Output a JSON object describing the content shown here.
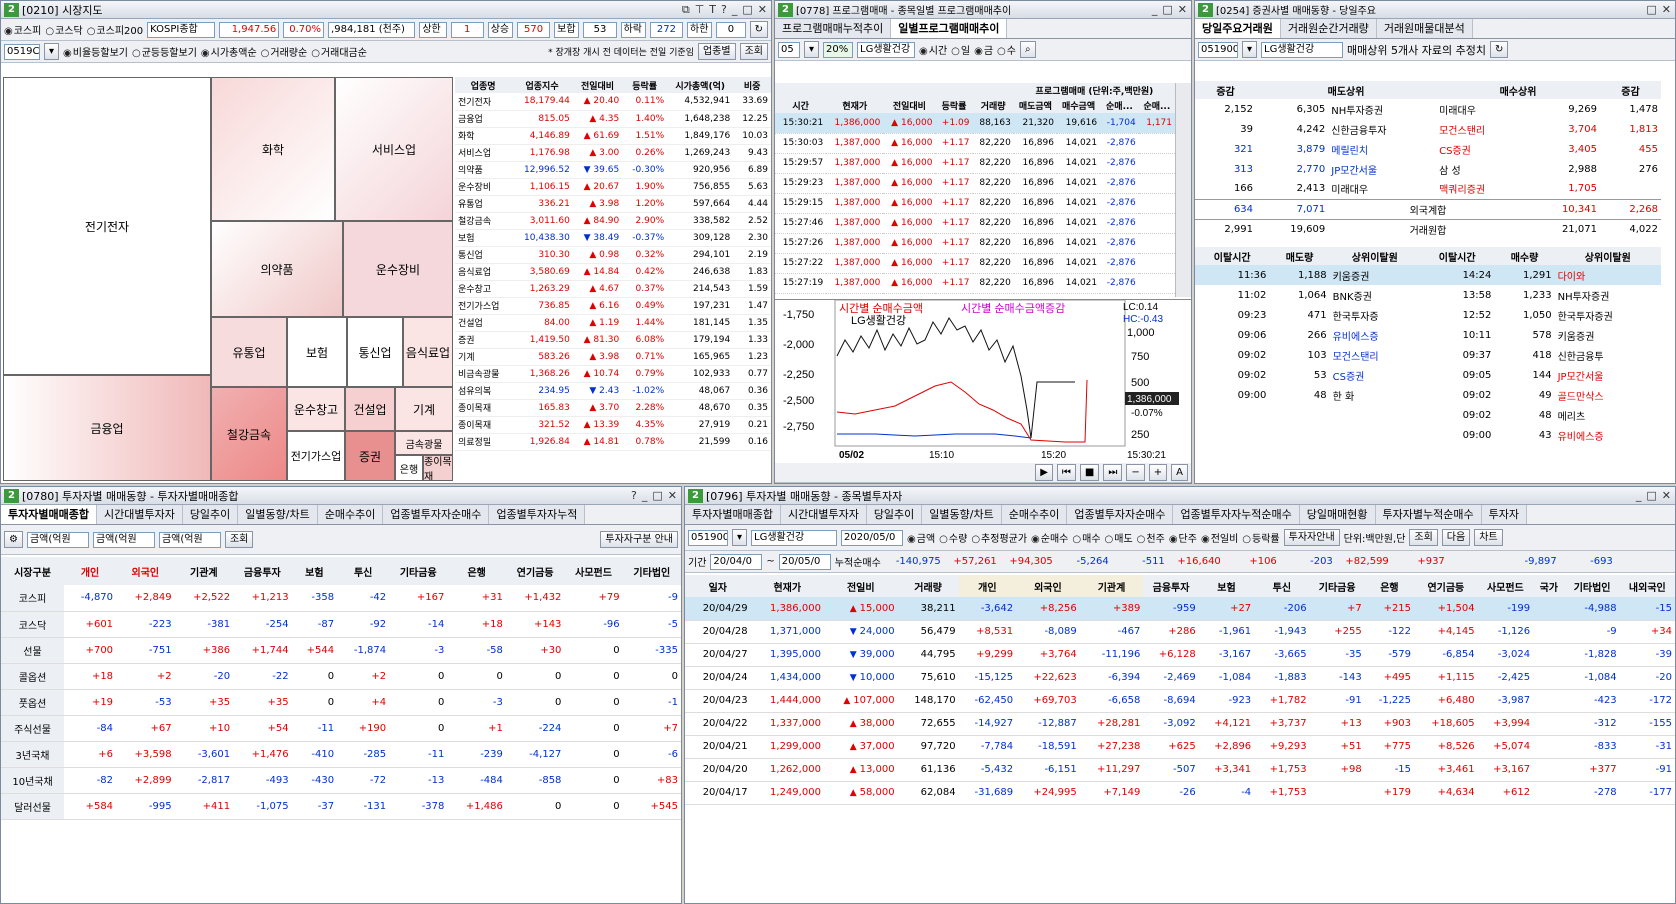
{
  "w1": {
    "num": "2",
    "title": "[0210] 시장지도",
    "markets": [
      "코스피",
      "코스닥",
      "코스피200"
    ],
    "index_name": "KOSPI종합",
    "index_val": "1,947.56",
    "index_pct": "0.70%",
    "index_amt": ",984,181 (천주)",
    "stats": [
      {
        "k": "상한",
        "v": "1"
      },
      {
        "k": "상승",
        "v": "570"
      },
      {
        "k": "보합",
        "v": "53"
      },
      {
        "k": "하락",
        "v": "272"
      },
      {
        "k": "하한",
        "v": "0"
      }
    ],
    "code": "0519C",
    "view_opts": [
      "비율등할보기",
      "균등등할보기"
    ],
    "size_opts": [
      "시가총액순",
      "거래량순",
      "거래대금순"
    ],
    "note": "* 장개장 개시 전 데이터는 전일 기준임",
    "btn_period": "업종별",
    "btn_search": "조회",
    "sectors": [
      "전기전자",
      "화학",
      "서비스업",
      "의약품",
      "운수장비",
      "유통업",
      "보험",
      "통신업",
      "음식료업",
      "금융업",
      "운수창고",
      "건설업",
      "기계",
      "철강금속",
      "전기가스업",
      "증권",
      "은행",
      "섬유의복",
      "종이목재",
      "금속광물"
    ],
    "table_head": [
      "업종명",
      "업종지수",
      "전일대비",
      "등락률",
      "시가총액(억)",
      "비중"
    ],
    "rows": [
      [
        "전기전자",
        "18,179.44",
        "up",
        "20.40",
        "0.11%",
        "4,532,941",
        "33.69"
      ],
      [
        "금융업",
        "815.05",
        "up",
        "4.35",
        "1.40%",
        "1,648,238",
        "12.25"
      ],
      [
        "화학",
        "4,146.89",
        "up",
        "61.69",
        "1.51%",
        "1,849,176",
        "10.03"
      ],
      [
        "서비스업",
        "1,176.98",
        "up",
        "3.00",
        "0.26%",
        "1,269,243",
        "9.43"
      ],
      [
        "의약품",
        "12,996.52",
        "dn",
        "39.65",
        "-0.30%",
        "920,956",
        "6.89"
      ],
      [
        "운수장비",
        "1,106.15",
        "up",
        "20.67",
        "1.90%",
        "756,855",
        "5.63"
      ],
      [
        "유통업",
        "336.21",
        "up",
        "3.98",
        "1.20%",
        "597,664",
        "4.44"
      ],
      [
        "철강금속",
        "3,011.60",
        "up",
        "84.90",
        "2.90%",
        "338,582",
        "2.52"
      ],
      [
        "보험",
        "10,438.30",
        "dn",
        "38.49",
        "-0.37%",
        "309,128",
        "2.30"
      ],
      [
        "통신업",
        "310.30",
        "up",
        "0.98",
        "0.32%",
        "294,101",
        "2.19"
      ],
      [
        "음식료업",
        "3,580.69",
        "up",
        "14.84",
        "0.42%",
        "246,638",
        "1.83"
      ],
      [
        "운수창고",
        "1,263.29",
        "up",
        "4.67",
        "0.37%",
        "214,543",
        "1.59"
      ],
      [
        "전기가스업",
        "736.85",
        "up",
        "6.16",
        "0.49%",
        "197,231",
        "1.47"
      ],
      [
        "건설업",
        "84.00",
        "up",
        "1.19",
        "1.44%",
        "181,145",
        "1.35"
      ],
      [
        "증권",
        "1,419.50",
        "up",
        "81.30",
        "6.08%",
        "179,194",
        "1.33"
      ],
      [
        "기계",
        "583.26",
        "up",
        "3.98",
        "0.71%",
        "165,965",
        "1.23"
      ],
      [
        "비금속광물",
        "1,368.26",
        "up",
        "10.74",
        "0.79%",
        "102,933",
        "0.77"
      ],
      [
        "섬유의복",
        "234.95",
        "dn",
        "2.43",
        "-1.02%",
        "48,067",
        "0.36"
      ],
      [
        "종이목재",
        "165.83",
        "up",
        "3.70",
        "2.28%",
        "48,670",
        "0.35"
      ],
      [
        "종이목재",
        "321.52",
        "up",
        "13.39",
        "4.35%",
        "27,919",
        "0.21"
      ],
      [
        "의료정밀",
        "1,926.84",
        "up",
        "14.81",
        "0.78%",
        "21,599",
        "0.16"
      ]
    ]
  },
  "w2": {
    "num": "2",
    "title": "[0778] 프로그램매매 - 종목일별 프로그램매매추이",
    "tabs": [
      "프로그램매매누적추이",
      "일별프로그램매매추이"
    ],
    "code": "05",
    "pct": "20%",
    "stock": "LG생활건강",
    "opts": [
      "시간",
      "일",
      "금",
      "수"
    ],
    "head": [
      "시간",
      "현재가",
      "전일대비",
      "등락률",
      "거래량",
      "매도금액",
      "매수금액",
      "순매...",
      "순매..."
    ],
    "head_group": "프로그램매매 (단위:주,백만원)",
    "rows": [
      [
        "15:30:21",
        "1,386,000",
        "16,000",
        "+1.09",
        "88,163",
        "21,320",
        "19,616",
        "-1,704",
        "1,171"
      ],
      [
        "15:30:03",
        "1,387,000",
        "16,000",
        "+1.17",
        "82,220",
        "16,896",
        "14,021",
        "-2,876",
        ""
      ],
      [
        "15:29:57",
        "1,387,000",
        "16,000",
        "+1.17",
        "82,220",
        "16,896",
        "14,021",
        "-2,876",
        ""
      ],
      [
        "15:29:23",
        "1,387,000",
        "16,000",
        "+1.17",
        "82,220",
        "16,896",
        "14,021",
        "-2,876",
        ""
      ],
      [
        "15:29:15",
        "1,387,000",
        "16,000",
        "+1.17",
        "82,220",
        "16,896",
        "14,021",
        "-2,876",
        ""
      ],
      [
        "15:27:46",
        "1,387,000",
        "16,000",
        "+1.17",
        "82,220",
        "16,896",
        "14,021",
        "-2,876",
        ""
      ],
      [
        "15:27:26",
        "1,387,000",
        "16,000",
        "+1.17",
        "82,220",
        "16,896",
        "14,021",
        "-2,876",
        ""
      ],
      [
        "15:27:22",
        "1,387,000",
        "16,000",
        "+1.17",
        "82,220",
        "16,896",
        "14,021",
        "-2,876",
        ""
      ],
      [
        "15:27:19",
        "1,387,000",
        "16,000",
        "+1.17",
        "82,220",
        "16,896",
        "14,021",
        "-2,876",
        ""
      ]
    ],
    "legend1": "시간별 순매수금액",
    "legend2": "시간별 순매수금액증감",
    "legend3": "LG생활건강",
    "lc": "LC:0.14",
    "hc": "HC:-0.43",
    "y_left": [
      "-1,750",
      "-2,000",
      "-2,250",
      "-2,500",
      "-2,750"
    ],
    "y_right": [
      "1,000",
      "750",
      "500",
      "250"
    ],
    "price_tag": "1,386,000",
    "pct_tag": "-0.07%",
    "x_labels": [
      "05/02",
      "15:10",
      "15:20",
      "15:30:21"
    ]
  },
  "w3": {
    "num": "2",
    "title": "[0254] 증권사별 매매동향 - 당일주요",
    "tabs": [
      "당일주요거래원",
      "거래원순간거래량",
      "거래원매물대분석"
    ],
    "code": "051900",
    "stock": "LG생활건강",
    "note": "매매상위 5개사 자료의 추정치",
    "head": [
      "증감",
      "매도상위",
      "매수상위",
      "증감"
    ],
    "rows": [
      [
        "2,152",
        "6,305",
        "NH투자증권",
        "미래대우",
        "9,269",
        "1,478"
      ],
      [
        "39",
        "4,242",
        "신한금융투자",
        "모건스탠리",
        "3,704",
        "1,813"
      ],
      [
        "321",
        "3,879",
        "메릴린치",
        "CS증권",
        "3,405",
        "455"
      ],
      [
        "313",
        "2,770",
        "JP모간서울",
        "삼 성",
        "2,988",
        "276"
      ],
      [
        "166",
        "2,413",
        "미래대우",
        "맥쿼리증권",
        "1,705",
        ""
      ]
    ],
    "foreign": [
      "634",
      "7,071",
      "외국계합",
      "10,341",
      "2,268"
    ],
    "total": [
      "2,991",
      "19,609",
      "거래원합",
      "21,071",
      "4,022"
    ],
    "head2": [
      "이탈시간",
      "매도량",
      "상위이탈원",
      "이탈시간",
      "매수량",
      "상위이탈원"
    ],
    "rows2": [
      [
        "11:36",
        "1,188",
        "키움증권",
        "14:24",
        "1,291",
        "다이와"
      ],
      [
        "11:02",
        "1,064",
        "BNK증권",
        "13:58",
        "1,233",
        "NH투자증권"
      ],
      [
        "09:23",
        "471",
        "한국투자증",
        "12:52",
        "1,050",
        "한국투자증권"
      ],
      [
        "09:06",
        "266",
        "유비에스증",
        "10:11",
        "578",
        "키움증권"
      ],
      [
        "09:02",
        "103",
        "모건스탠리",
        "09:37",
        "418",
        "신한금융투"
      ],
      [
        "09:02",
        "53",
        "CS증권",
        "09:05",
        "144",
        "JP모간서울"
      ],
      [
        "09:00",
        "48",
        "한 화",
        "09:02",
        "49",
        "골드만삭스"
      ],
      [
        "",
        "",
        "",
        "09:02",
        "48",
        "메리츠"
      ],
      [
        "",
        "",
        "",
        "09:00",
        "43",
        "유비에스증"
      ]
    ]
  },
  "w4": {
    "num": "2",
    "title": "[0780] 투자자별 매매동향 - 투자자별매매종합",
    "tabs": [
      "투자자별매매종합",
      "시간대별투자자",
      "당일추이",
      "일별동향/차트",
      "순매수추이",
      "업종별투자자순매수",
      "업종별투자자누적"
    ],
    "sel1": "금액(억원",
    "sel2": "금액(억원",
    "sel3": "금액(억원",
    "btn": "조회",
    "btn2": "투자자구분 안내",
    "head": [
      "시장구분",
      "개인",
      "외국인",
      "기관계",
      "금융투자",
      "보험",
      "투신",
      "기타금융",
      "은행",
      "연기금등",
      "사모펀드",
      "기타법인"
    ],
    "rows": [
      [
        "코스피",
        "-4,870",
        "+2,849",
        "+2,522",
        "+1,213",
        "-358",
        "-42",
        "+167",
        "+31",
        "+1,432",
        "+79",
        "-9"
      ],
      [
        "코스닥",
        "+601",
        "-223",
        "-381",
        "-254",
        "-87",
        "-92",
        "-14",
        "+18",
        "+143",
        "-96",
        "-5"
      ],
      [
        "선물",
        "+700",
        "-751",
        "+386",
        "+1,744",
        "+544",
        "-1,874",
        "-3",
        "-58",
        "+30",
        "0",
        "-335"
      ],
      [
        "콜옵션",
        "+18",
        "+2",
        "-20",
        "-22",
        "0",
        "+2",
        "0",
        "0",
        "0",
        "0",
        "0"
      ],
      [
        "풋옵션",
        "+19",
        "-53",
        "+35",
        "+35",
        "0",
        "+4",
        "0",
        "-3",
        "0",
        "0",
        "-1"
      ],
      [
        "주식선물",
        "-84",
        "+67",
        "+10",
        "+54",
        "-11",
        "+190",
        "0",
        "+1",
        "-224",
        "0",
        "+7"
      ],
      [
        "3년국채",
        "+6",
        "+3,598",
        "-3,601",
        "+1,476",
        "-410",
        "-285",
        "-11",
        "-239",
        "-4,127",
        "0",
        "-6"
      ],
      [
        "10년국채",
        "-82",
        "+2,899",
        "-2,817",
        "-493",
        "-430",
        "-72",
        "-13",
        "-484",
        "-858",
        "0",
        "+83"
      ],
      [
        "달러선물",
        "+584",
        "-995",
        "+411",
        "-1,075",
        "-37",
        "-131",
        "-378",
        "+1,486",
        "0",
        "0",
        "+545"
      ]
    ]
  },
  "w5": {
    "num": "2",
    "title": "[0796] 투자자별 매매동향 - 종목별투자자",
    "tabs": [
      "투자자별매매종합",
      "시간대별투자자",
      "당일추이",
      "일별동향/차트",
      "순매수추이",
      "업종별투자자순매수",
      "업종별투자자누적순매수",
      "당일매매현황",
      "투자자별누적순매수",
      "투자자"
    ],
    "code": "051900",
    "stock": "LG생활건강",
    "date": "2020/05/0",
    "opts1": [
      "금액",
      "수량",
      "추정평균가"
    ],
    "opts2": [
      "순매수",
      "매수",
      "매도"
    ],
    "opts3": [
      "천주",
      "단주"
    ],
    "opts4": [
      "전일비",
      "등락률"
    ],
    "btn_guide": "투자자안내",
    "unit": "단위:백만원,단",
    "btn_search": "조회",
    "btn_next": "다음",
    "btn_chart": "차트",
    "period_label": "기간",
    "from": "20/04/0",
    "to": "20/05/0",
    "cum_label": "누적순매수",
    "cum": [
      "-140,975",
      "+57,261",
      "+94,305",
      "-5,264",
      "-511",
      "+16,640",
      "+106",
      "-203",
      "+82,599",
      "+937",
      "",
      "-9,897",
      "-693"
    ],
    "head": [
      "일자",
      "현재가",
      "전일비",
      "거래량",
      "개인",
      "외국인",
      "기관계",
      "금융투자",
      "보험",
      "투신",
      "기타금융",
      "은행",
      "연기금등",
      "사모펀드",
      "국가",
      "기타법인",
      "내외국인"
    ],
    "rows": [
      [
        "20/04/29",
        "1,386,000",
        "up",
        "15,000",
        "38,211",
        "-3,642",
        "+8,256",
        "+389",
        "-959",
        "+27",
        "-206",
        "+7",
        "+215",
        "+1,504",
        "-199",
        "",
        "-4,988",
        "-15"
      ],
      [
        "20/04/28",
        "1,371,000",
        "dn",
        "24,000",
        "56,479",
        "+8,531",
        "-8,089",
        "-467",
        "+286",
        "-1,961",
        "-1,943",
        "+255",
        "-122",
        "+4,145",
        "-1,126",
        "",
        "-9",
        "+34"
      ],
      [
        "20/04/27",
        "1,395,000",
        "dn",
        "39,000",
        "44,795",
        "+9,299",
        "+3,764",
        "-11,196",
        "+6,128",
        "-3,167",
        "-3,665",
        "-35",
        "-579",
        "-6,854",
        "-3,024",
        "",
        "-1,828",
        "-39"
      ],
      [
        "20/04/24",
        "1,434,000",
        "dn",
        "10,000",
        "75,610",
        "-15,125",
        "+22,623",
        "-6,394",
        "-2,469",
        "-1,084",
        "-1,883",
        "-143",
        "+495",
        "+1,115",
        "-2,425",
        "",
        "-1,084",
        "-20"
      ],
      [
        "20/04/23",
        "1,444,000",
        "up",
        "107,000",
        "148,170",
        "-62,450",
        "+69,703",
        "-6,658",
        "-8,694",
        "-923",
        "+1,782",
        "-91",
        "-1,225",
        "+6,480",
        "-3,987",
        "",
        "-423",
        "-172"
      ],
      [
        "20/04/22",
        "1,337,000",
        "up",
        "38,000",
        "72,655",
        "-14,927",
        "-12,887",
        "+28,281",
        "-3,092",
        "+4,121",
        "+3,737",
        "+13",
        "+903",
        "+18,605",
        "+3,994",
        "",
        "-312",
        "-155"
      ],
      [
        "20/04/21",
        "1,299,000",
        "up",
        "37,000",
        "97,720",
        "-7,784",
        "-18,591",
        "+27,238",
        "+625",
        "+2,896",
        "+9,293",
        "+51",
        "+775",
        "+8,526",
        "+5,074",
        "",
        "-833",
        "-31"
      ],
      [
        "20/04/20",
        "1,262,000",
        "up",
        "13,000",
        "61,136",
        "-5,432",
        "-6,151",
        "+11,297",
        "-507",
        "+3,341",
        "+1,753",
        "+98",
        "-15",
        "+3,461",
        "+3,167",
        "",
        "+377",
        "-91"
      ],
      [
        "20/04/17",
        "1,249,000",
        "up",
        "58,000",
        "62,084",
        "-31,689",
        "+24,995",
        "+7,149",
        "-26",
        "-4",
        "+1,753",
        "",
        "+179",
        "+4,634",
        "+612",
        "",
        "-278",
        "-177"
      ]
    ]
  },
  "colors": {
    "up": "#e00000",
    "down": "#0030d0",
    "sel_row": "#cfe6f4"
  }
}
